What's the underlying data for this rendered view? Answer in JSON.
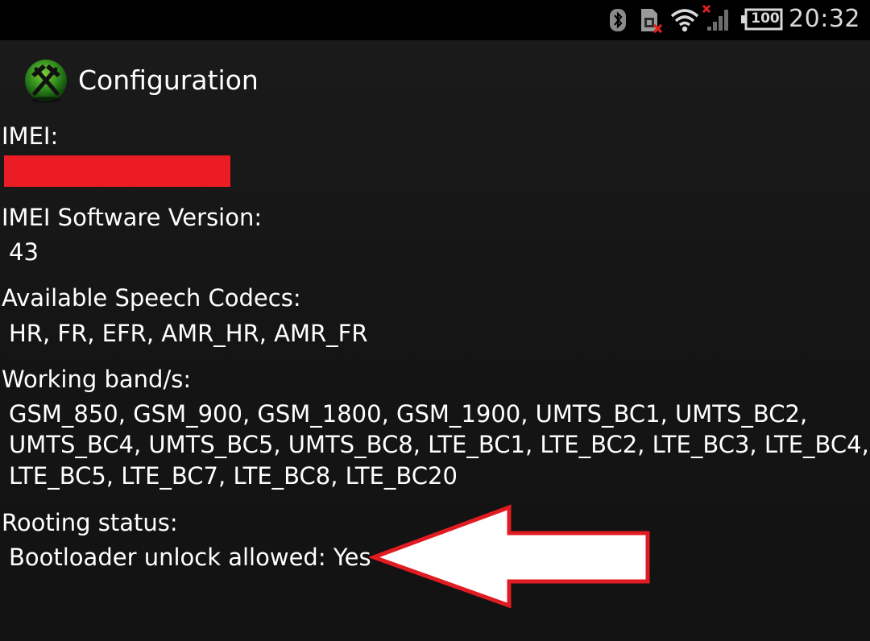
{
  "status_bar": {
    "time": "20:32",
    "battery_level": "100",
    "icons": [
      "bluetooth-icon",
      "sim-card-error-icon",
      "wifi-icon",
      "signal-strength-no-service-icon",
      "battery-icon"
    ]
  },
  "action_bar": {
    "title": "Configuration",
    "app_icon": "crossed-hammers-icon"
  },
  "sections": {
    "imei": {
      "label": "IMEI:",
      "value_redacted": true
    },
    "imei_sv": {
      "label": "IMEI Software Version:",
      "value": "43"
    },
    "codecs": {
      "label": "Available Speech Codecs:",
      "value": "HR, FR, EFR, AMR_HR, AMR_FR"
    },
    "bands": {
      "label": "Working band/s:",
      "lines": [
        "GSM_850, GSM_900, GSM_1800, GSM_1900, UMTS_BC1, UMTS_BC2,",
        "UMTS_BC4, UMTS_BC5, UMTS_BC8, LTE_BC1, LTE_BC2, LTE_BC3, LTE_BC4,",
        "LTE_BC5, LTE_BC7, LTE_BC8, LTE_BC20"
      ]
    },
    "rooting": {
      "label": "Rooting status:",
      "value": "Bootloader unlock allowed: Yes"
    }
  },
  "colors": {
    "background": "#151515",
    "status_bar": "#000000",
    "redaction": "#ec1c24",
    "arrow_outline": "#e11b22",
    "arrow_fill": "#ffffff"
  }
}
